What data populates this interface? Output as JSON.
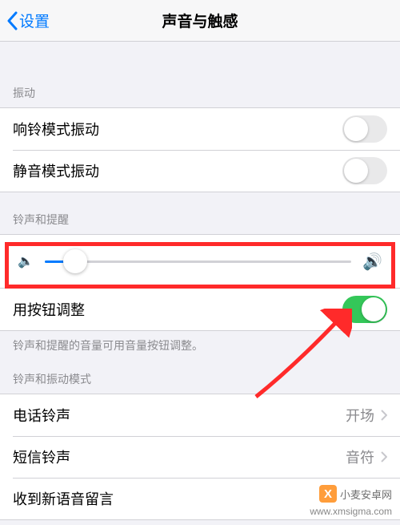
{
  "navbar": {
    "back_label": "设置",
    "title": "声音与触感"
  },
  "vibration": {
    "header": "振动",
    "rows": [
      {
        "label": "响铃模式振动",
        "on": false
      },
      {
        "label": "静音模式振动",
        "on": false
      }
    ]
  },
  "ringer": {
    "header": "铃声和提醒",
    "slider_value_pct": 10,
    "icons": {
      "low": "🔈",
      "high": "🔊"
    },
    "button_adjust": {
      "label": "用按钮调整",
      "on": true
    },
    "footer": "铃声和提醒的音量可用音量按钮调整。"
  },
  "patterns": {
    "header": "铃声和振动模式",
    "rows": [
      {
        "label": "电话铃声",
        "value": "开场"
      },
      {
        "label": "短信铃声",
        "value": "音符"
      },
      {
        "label": "收到新语音留言",
        "value": ""
      }
    ]
  },
  "watermark": {
    "brand_x": "X",
    "brand": "小麦安卓网",
    "url": "www.xmsigma.com"
  }
}
